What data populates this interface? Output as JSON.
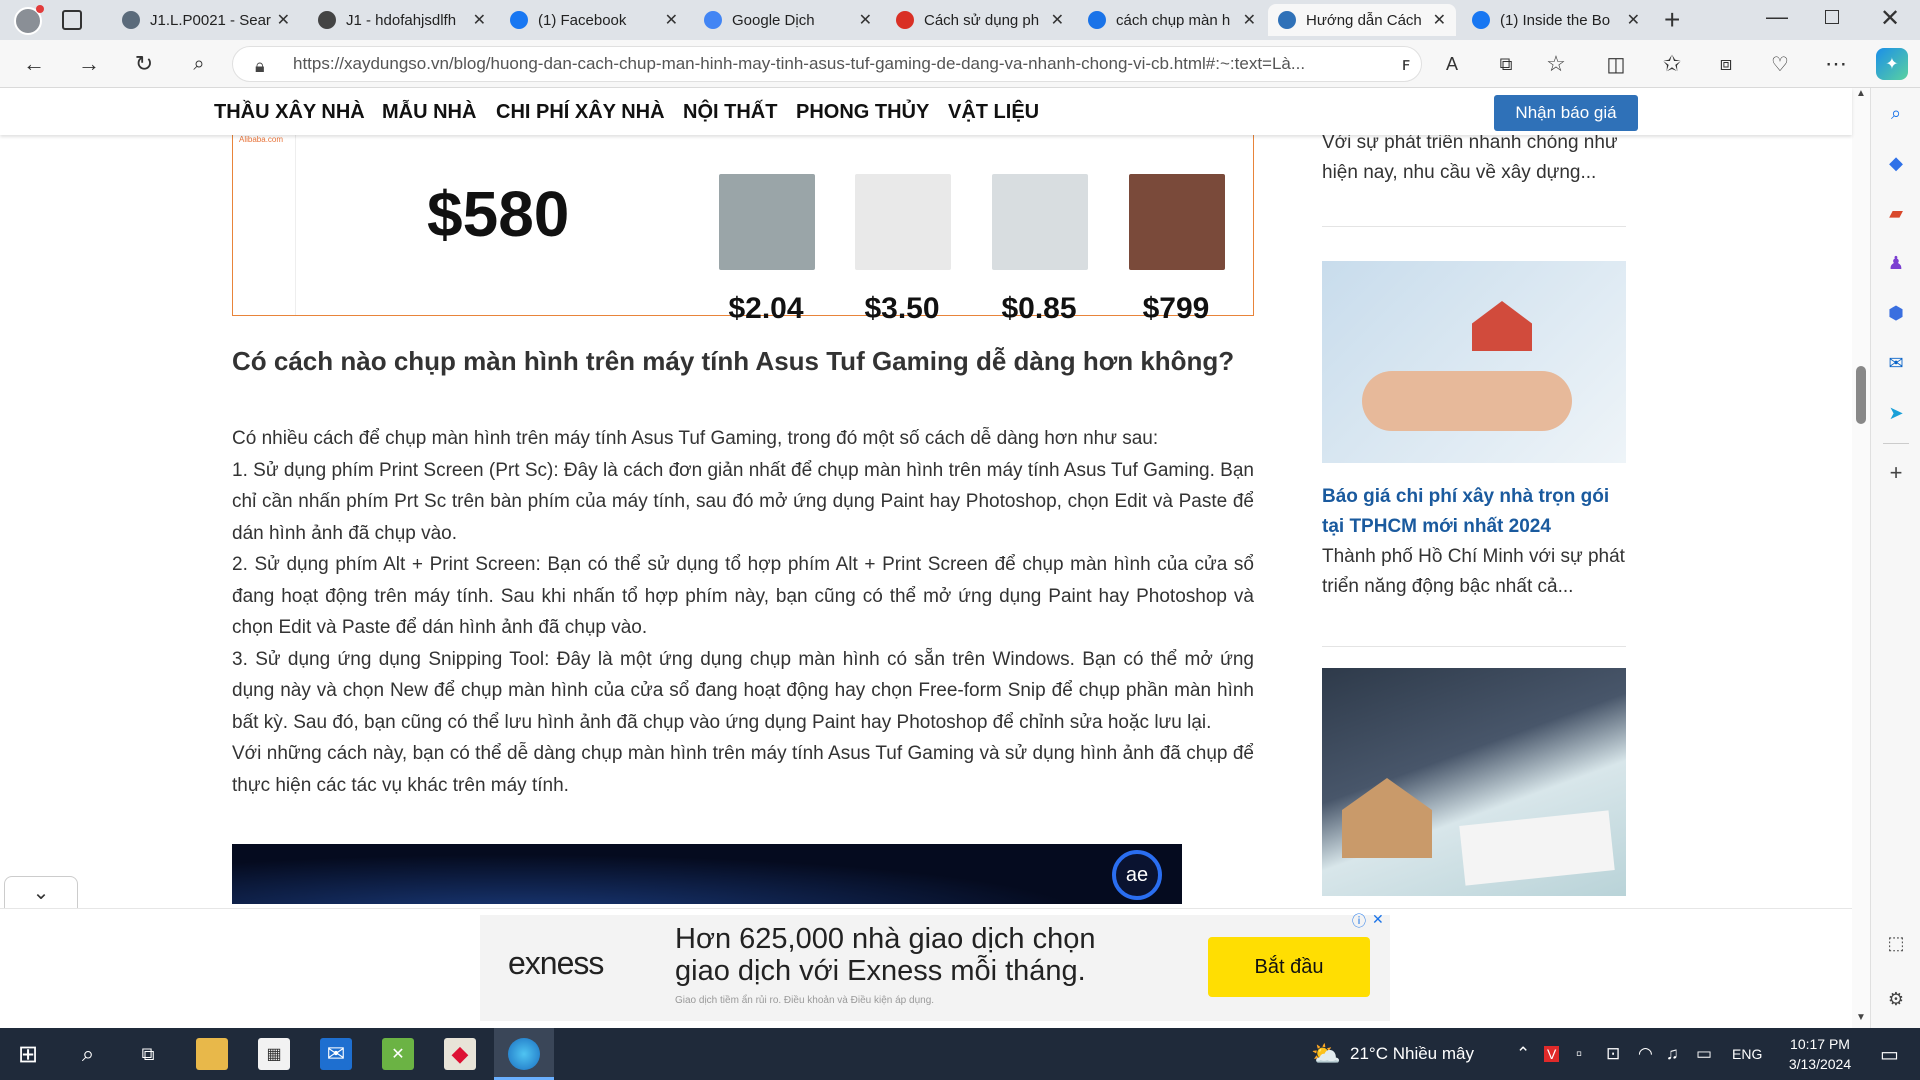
{
  "browser": {
    "tabs": [
      {
        "title": "J1.L.P0021 - Sear",
        "favicon": "search-icon",
        "color": "#5b6b7b"
      },
      {
        "title": "J1 - hdofahjsdlfh",
        "favicon": "github-icon",
        "color": "#444444"
      },
      {
        "title": "(1) Facebook",
        "favicon": "facebook-icon",
        "color": "#1877f2"
      },
      {
        "title": "Google Dịch",
        "favicon": "translate-icon",
        "color": "#4285f4"
      },
      {
        "title": "Cách sử dụng ph",
        "favicon": "t-icon",
        "color": "#d93025"
      },
      {
        "title": "cách chụp màn h",
        "favicon": "search-icon",
        "color": "#1a73e8"
      },
      {
        "title": "Hướng dẫn Cách",
        "favicon": "site-icon",
        "color": "#2f71b8"
      },
      {
        "title": "(1) Inside the Bo",
        "favicon": "facebook-icon",
        "color": "#1877f2"
      }
    ],
    "active_tab": 6,
    "url": "https://xaydungso.vn/blog/huong-dan-cach-chup-man-hinh-may-tinh-asus-tuf-gaming-de-dang-va-nhanh-chong-vi-cb.html#:~:text=Là..."
  },
  "site": {
    "menu": [
      "THẦU XÂY NHÀ",
      "MẪU NHÀ",
      "CHI PHÍ XÂY NHÀ",
      "NỘI THẤT",
      "PHONG THỦY",
      "VẬT LIỆU"
    ],
    "quote_button": "Nhận báo giá"
  },
  "ad_top": {
    "brand": "Alibaba.com",
    "main_price": "$580",
    "products": [
      {
        "price": "$2.04",
        "color": "#9aa5a8"
      },
      {
        "price": "$3.50",
        "color": "#e9e9e9"
      },
      {
        "price": "$0.85",
        "color": "#d8dde0"
      },
      {
        "price": "$799",
        "color": "#7a4a3a"
      }
    ]
  },
  "article": {
    "heading": "Có cách nào chụp màn hình trên máy tính Asus Tuf Gaming dễ dàng hơn không?",
    "paragraphs": [
      "Có nhiều cách để chụp màn hình trên máy tính Asus Tuf Gaming, trong đó một số cách dễ dàng hơn như sau:",
      "1. Sử dụng phím Print Screen (Prt Sc): Đây là cách đơn giản nhất để chụp màn hình trên máy tính Asus Tuf Gaming. Bạn chỉ cần nhấn phím Prt Sc trên bàn phím của máy tính, sau đó mở ứng dụng Paint hay Photoshop, chọn Edit và Paste để dán hình ảnh đã chụp vào.",
      "2. Sử dụng phím Alt + Print Screen: Bạn có thể sử dụng tổ hợp phím Alt + Print Screen để chụp màn hình của cửa sổ đang hoạt động trên máy tính. Sau khi nhấn tổ hợp phím này, bạn cũng có thể mở ứng dụng Paint hay Photoshop và chọn Edit và Paste để dán hình ảnh đã chụp vào.",
      "3. Sử dụng ứng dụng Snipping Tool: Đây là một ứng dụng chụp màn hình có sẵn trên Windows. Bạn có thể mở ứng dụng này và chọn New để chụp màn hình của cửa sổ đang hoạt động hay chọn Free-form Snip để chụp phần màn hình bất kỳ. Sau đó, bạn cũng có thể lưu hình ảnh đã chụp vào ứng dụng Paint hay Photoshop để chỉnh sửa hoặc lưu lại.",
      "Với những cách này, bạn có thể dễ dàng chụp màn hình trên máy tính Asus Tuf Gaming và sử dụng hình ảnh đã chụp để thực hiện các tác vụ khác trên máy tính."
    ]
  },
  "sidebar": {
    "snippet_top": "Với sự phát triển nhanh chóng như hiện nay, nhu cầu về xây dựng...",
    "card2": {
      "title": "Báo giá chi phí xây nhà trọn gói tại TPHCM mới nhất 2024",
      "snippet": "Thành phố Hồ Chí Minh với sự phát triển năng động bậc nhất cả..."
    }
  },
  "bottom_ad": {
    "brand": "exness",
    "headline": "Hơn 625,000 nhà giao dịch chọn giao dịch với Exness mỗi tháng.",
    "fine_print": "Giao dịch tiềm ẩn rủi ro. Điều khoản và Điều kiện áp dụng.",
    "cta": "Bắt đầu",
    "accent": "#ffde02"
  },
  "taskbar": {
    "weather": "21°C  Nhiều mây",
    "lang": "ENG",
    "time": "10:17 PM",
    "date": "3/13/2024"
  }
}
